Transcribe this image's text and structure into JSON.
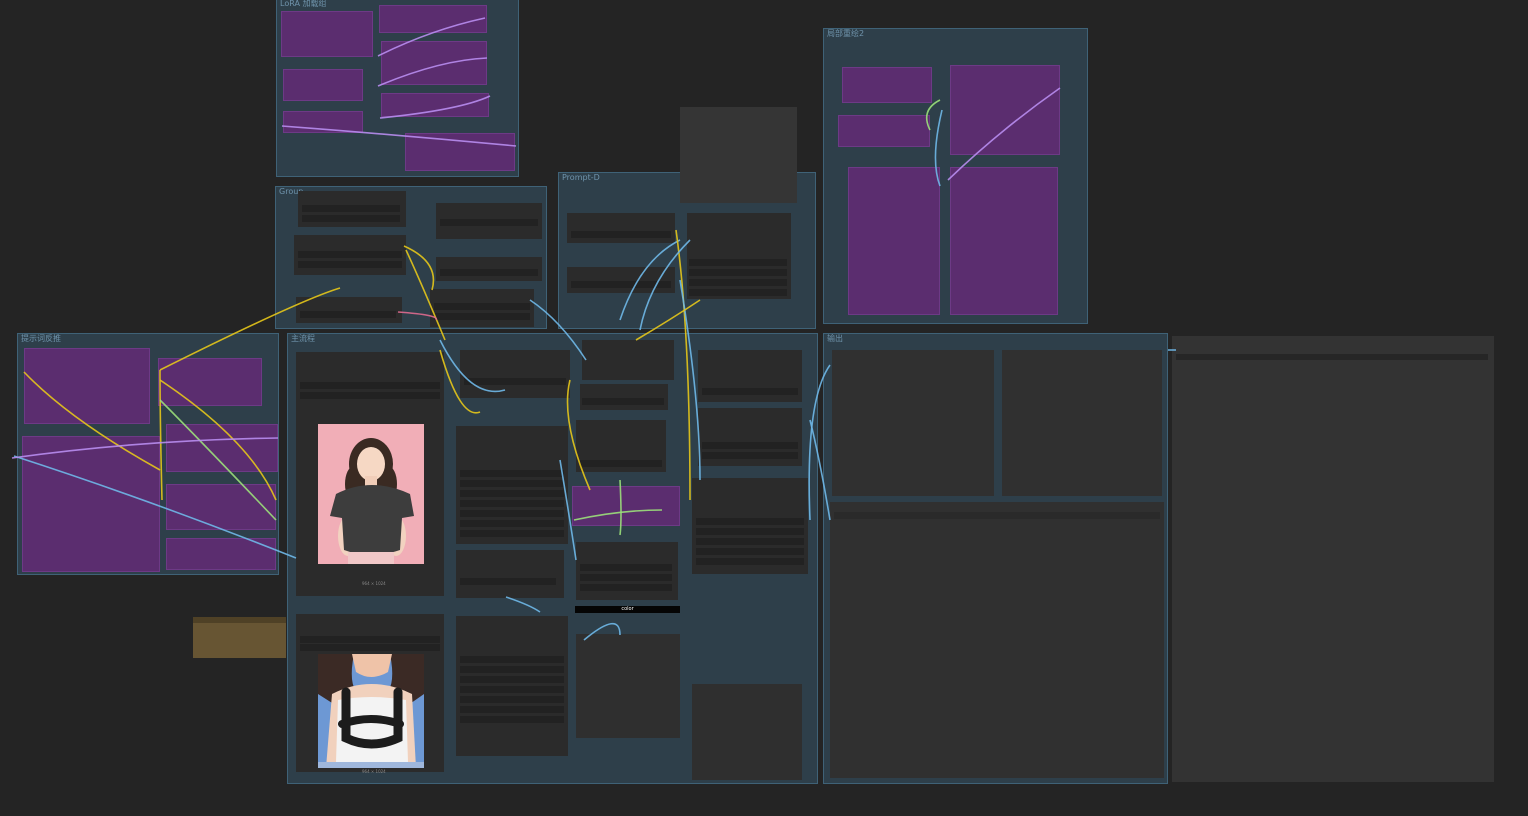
{
  "canvas": {
    "background": "#242424"
  },
  "groups": [
    {
      "id": "lora-group",
      "title": "LoRA 加载组"
    },
    {
      "id": "group-b",
      "title": "Group"
    },
    {
      "id": "prompt-group",
      "title": "Prompt-D"
    },
    {
      "id": "repaint-group",
      "title": "局部重绘2"
    },
    {
      "id": "side-group",
      "title": "提示词反推"
    },
    {
      "id": "main-group",
      "title": "主流程"
    },
    {
      "id": "output-group",
      "title": "输出"
    }
  ],
  "images": [
    {
      "id": "portrait-a",
      "caption": "964 × 1024",
      "subject": "woman-pink-background-black-top"
    },
    {
      "id": "portrait-b",
      "caption": "964 × 1024",
      "subject": "woman-white-top-black-mask"
    }
  ],
  "toast": {
    "label": "color"
  },
  "colors": {
    "group_bg": "#2e3f4a",
    "group_border": "#3f6277",
    "node_bg": "#333333",
    "purple_node": "#5b2d6f",
    "note": "#675533",
    "wire_yellow": "#e6c619",
    "wire_blue": "#6fb8e8",
    "wire_purple": "#b88df0",
    "wire_green": "#9be07a",
    "wire_pink": "#e06a8f"
  }
}
